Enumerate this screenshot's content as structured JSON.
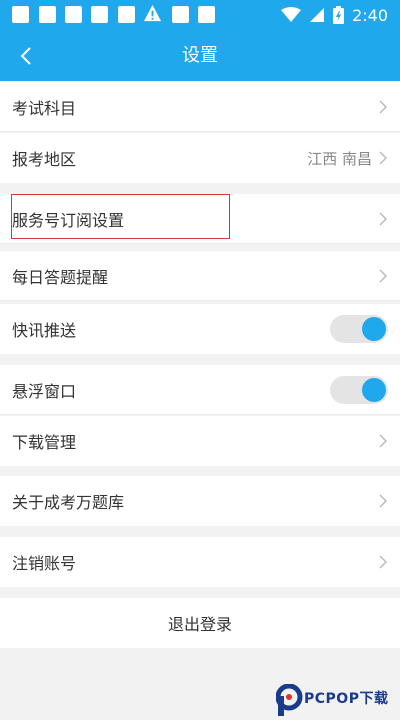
{
  "status_bar": {
    "time": "2:40",
    "icons": [
      "notification-icon",
      "notification-icon",
      "notification-icon",
      "notification-icon",
      "notification-icon",
      "notification-icon",
      "warning-icon",
      "notification-icon",
      "notification-icon",
      "wifi-icon",
      "signal-icon",
      "battery-icon"
    ]
  },
  "header": {
    "title": "设置",
    "back_icon": "chevron-left-icon"
  },
  "settings": {
    "exam_subject": {
      "label": "考试科目"
    },
    "exam_region": {
      "label": "报考地区",
      "value": "江西 南昌"
    },
    "service_subscription": {
      "label": "服务号订阅设置"
    },
    "daily_reminder": {
      "label": "每日答题提醒"
    },
    "news_push": {
      "label": "快讯推送",
      "enabled": true
    },
    "floating_window": {
      "label": "悬浮窗口",
      "enabled": true
    },
    "download_manage": {
      "label": "下载管理"
    },
    "about": {
      "label": "关于成考万题库"
    },
    "cancel_account": {
      "label": "注销账号"
    },
    "logout": {
      "label": "退出登录"
    }
  },
  "watermark": {
    "text": "PCPOP下载"
  },
  "colors": {
    "accent": "#1fa8ec",
    "highlight_border": "#d8323c",
    "background": "#f2f2f2"
  }
}
